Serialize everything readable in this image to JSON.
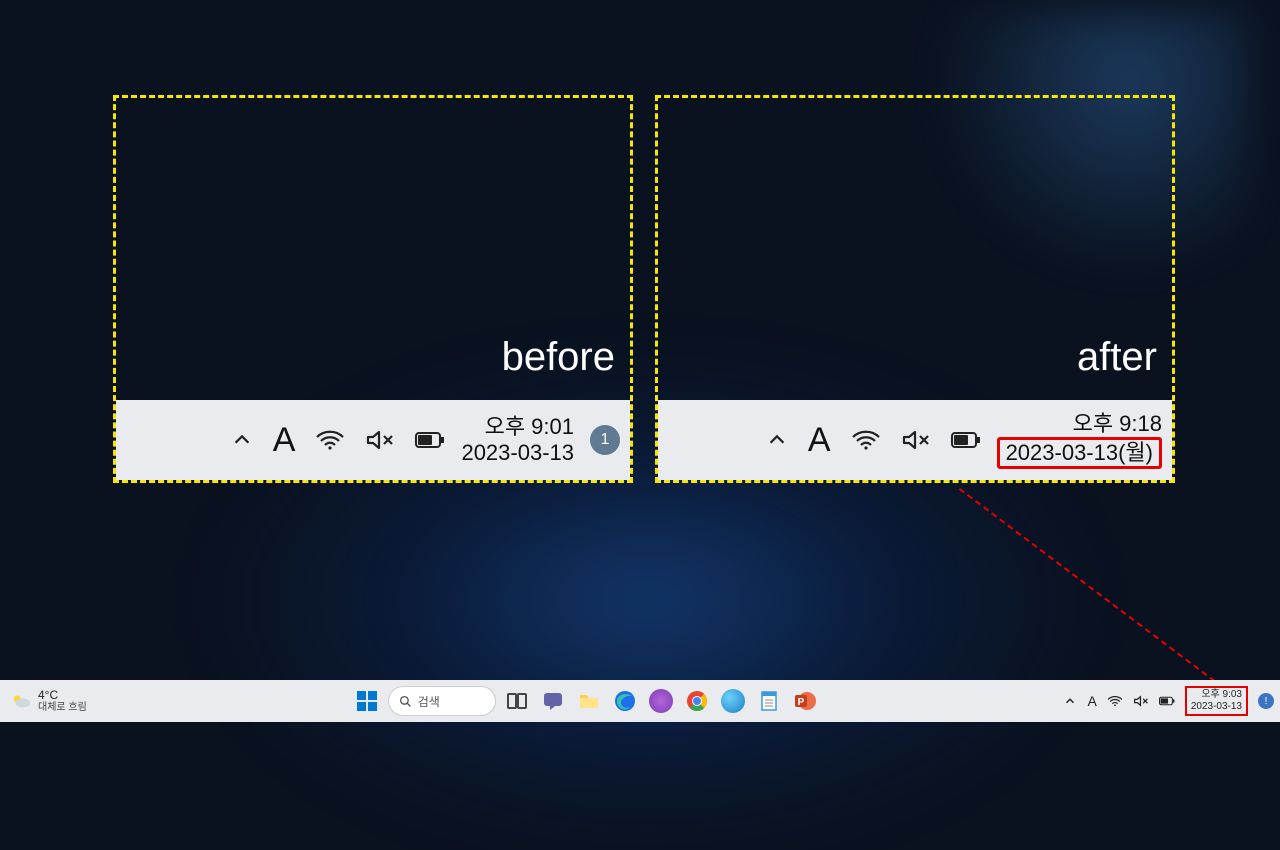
{
  "panels": {
    "before": {
      "label": "before",
      "time": "오후 9:01",
      "date": "2023-03-13",
      "badge": "1"
    },
    "after": {
      "label": "after",
      "time": "오후 9:18",
      "date": "2023-03-13(월)"
    }
  },
  "taskbar": {
    "weather": {
      "temp": "4°C",
      "desc": "대체로 흐림"
    },
    "search": {
      "placeholder": "검색"
    },
    "clock": {
      "time": "오후 9:03",
      "date": "2023-03-13"
    },
    "ime": "A",
    "apps": [
      {
        "name": "start",
        "color": "#0078d4"
      },
      {
        "name": "task-view",
        "color": "#555"
      },
      {
        "name": "chat",
        "color": "#6264a7"
      },
      {
        "name": "file-explorer",
        "color": "#ffcc33"
      },
      {
        "name": "edge",
        "color": "#1f6feb"
      },
      {
        "name": "samsung-app",
        "color": "#7a3db8"
      },
      {
        "name": "chrome",
        "color": "#ea4335"
      },
      {
        "name": "paint3d",
        "color": "#3aa5dd"
      },
      {
        "name": "notepad",
        "color": "#3a9ad9"
      },
      {
        "name": "powerpoint",
        "color": "#d24726"
      }
    ]
  },
  "icons": {
    "chevron_up": "chevron-up-icon",
    "ime": "A",
    "wifi": "wifi-icon",
    "volume_muted": "volume-muted-icon",
    "battery": "battery-icon"
  }
}
